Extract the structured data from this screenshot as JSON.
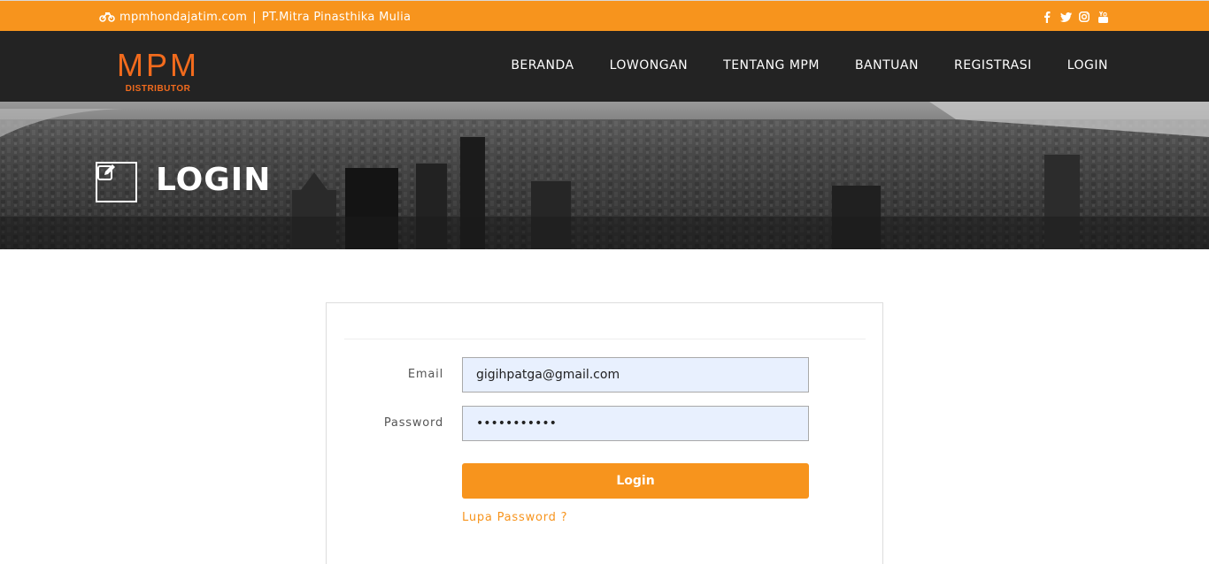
{
  "topbar": {
    "site": "mpmhondajatim.com",
    "separator": "|",
    "company": "PT.Mitra Pinasthika Mulia",
    "social": [
      {
        "name": "facebook-icon",
        "glyph": "f"
      },
      {
        "name": "twitter-icon",
        "glyph": "t"
      },
      {
        "name": "instagram-icon",
        "glyph": "◎"
      },
      {
        "name": "youtube-icon",
        "glyph": "▶"
      }
    ],
    "color": "#f7941d"
  },
  "logo": {
    "text": "MPM",
    "subtitle": "DISTRIBUTOR",
    "color": "#f26b1d"
  },
  "nav": {
    "items": [
      "BERANDA",
      "LOWONGAN",
      "TENTANG MPM",
      "BANTUAN",
      "REGISTRASI",
      "LOGIN"
    ]
  },
  "hero": {
    "title": "LOGIN",
    "icon": "edit-icon"
  },
  "form": {
    "email_label": "Email",
    "email_value": "gigihpatga@gmail.com",
    "password_label": "Password",
    "password_value": "•••••••••••",
    "submit_label": "Login",
    "forgot_label": "Lupa Password ?"
  }
}
